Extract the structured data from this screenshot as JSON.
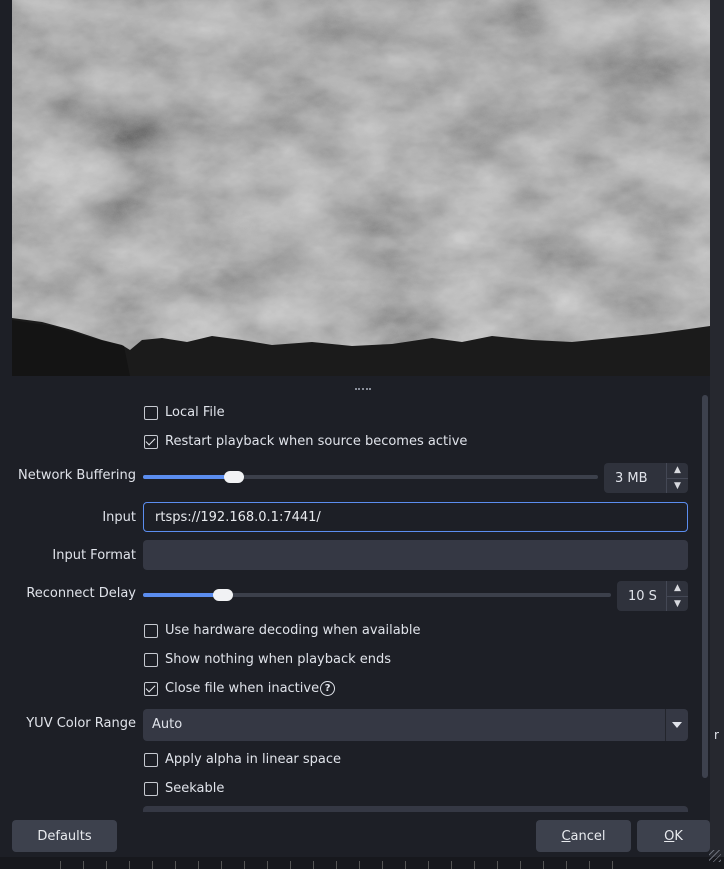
{
  "checkboxes": {
    "local_file": {
      "label": "Local File",
      "checked": false
    },
    "restart_playback": {
      "label": "Restart playback when source becomes active",
      "checked": true
    },
    "hw_decoding": {
      "label": "Use hardware decoding when available",
      "checked": false
    },
    "show_nothing": {
      "label": "Show nothing when playback ends",
      "checked": false
    },
    "close_inactive": {
      "label": "Close file when inactive",
      "checked": true
    },
    "alpha_linear": {
      "label": "Apply alpha in linear space",
      "checked": false
    },
    "seekable": {
      "label": "Seekable",
      "checked": false
    }
  },
  "network_buffering": {
    "label": "Network Buffering",
    "value": "3 MB",
    "level": 0.2
  },
  "input": {
    "label": "Input",
    "value": "rtsps://192.168.0.1:7441/"
  },
  "input_format": {
    "label": "Input Format",
    "value": ""
  },
  "reconnect_delay": {
    "label": "Reconnect Delay",
    "value": "10 S",
    "level": 0.17
  },
  "yuv_color_range": {
    "label": "YUV Color Range",
    "value": "Auto"
  },
  "buttons": {
    "defaults": "Defaults",
    "cancel": "Cancel",
    "ok": "OK"
  },
  "icons": {
    "help": "help-circle-icon",
    "spin_up": "chevron-up-icon",
    "spin_down": "chevron-down-icon",
    "dropdown": "dropdown-arrow-icon"
  },
  "colors": {
    "accent": "#5b8def",
    "background": "#1d1f26",
    "field": "#353844"
  },
  "right_edge_fragment": "r"
}
